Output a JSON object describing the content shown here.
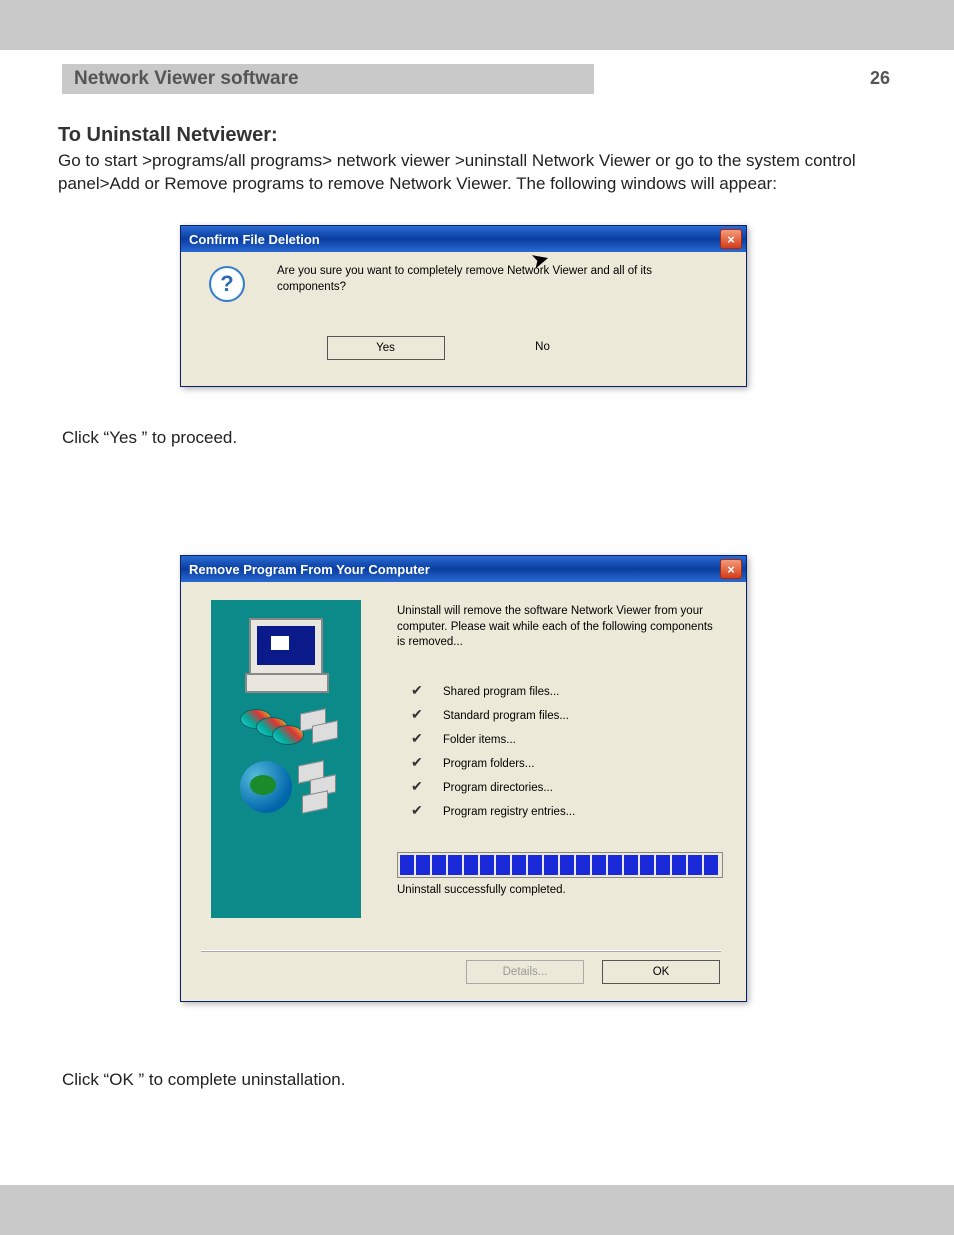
{
  "header": {
    "title": "Network Viewer software",
    "page_number": "26"
  },
  "section": {
    "title": "To Uninstall Netviewer:",
    "body": "Go to start >programs/all programs> network viewer >uninstall Network Viewer or go to the system control panel>Add or Remove programs to remove Network Viewer. The following windows will appear:"
  },
  "dialog_confirm": {
    "title": "Confirm File Deletion",
    "message": "Are you sure you want to completely remove Network Viewer and all of its components?",
    "yes": "Yes",
    "no": "No",
    "close": "×"
  },
  "caption_yes": "Click “Yes ” to proceed.",
  "dialog_remove": {
    "title": "Remove Program From Your Computer",
    "description": "Uninstall will remove the software Network Viewer from your computer. Please wait while each of the following components is removed...",
    "items": [
      "Shared program files...",
      "Standard program files...",
      "Folder items...",
      "Program folders...",
      "Program directories...",
      "Program registry entries..."
    ],
    "status": "Uninstall successfully completed.",
    "details": "Details...",
    "ok": "OK",
    "close": "×"
  },
  "caption_ok": "Click “OK ” to complete uninstallation."
}
